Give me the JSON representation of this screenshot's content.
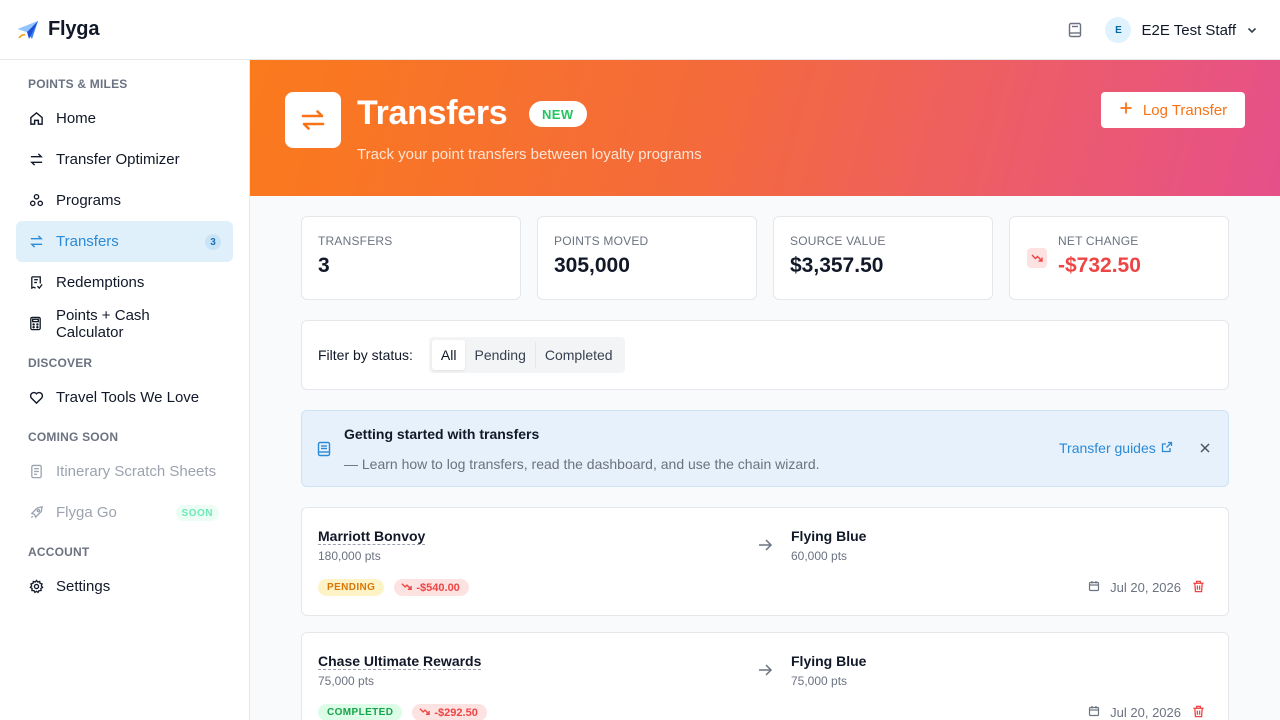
{
  "app": {
    "brand": "Flyga",
    "user_initial": "E",
    "user_name": "E2E Test Staff"
  },
  "sidebar": {
    "sections": [
      {
        "title": "POINTS & MILES",
        "items": [
          {
            "label": "Home",
            "icon": "home-icon"
          },
          {
            "label": "Transfer Optimizer",
            "icon": "swap-icon"
          },
          {
            "label": "Programs",
            "icon": "programs-icon"
          },
          {
            "label": "Transfers",
            "icon": "transfer-icon",
            "active": true,
            "count": "3"
          },
          {
            "label": "Redemptions",
            "icon": "receipt-icon"
          },
          {
            "label": "Points + Cash Calculator",
            "icon": "calculator-icon"
          }
        ]
      },
      {
        "title": "DISCOVER",
        "items": [
          {
            "label": "Travel Tools We Love",
            "icon": "heart-icon"
          }
        ]
      },
      {
        "title": "COMING SOON",
        "items": [
          {
            "label": "Itinerary Scratch Sheets",
            "icon": "notes-icon",
            "disabled": true
          },
          {
            "label": "Flyga Go",
            "icon": "rocket-icon",
            "disabled": true,
            "badge": "SOON"
          }
        ]
      },
      {
        "title": "ACCOUNT",
        "items": [
          {
            "label": "Settings",
            "icon": "gear-icon"
          }
        ]
      }
    ]
  },
  "hero": {
    "title": "Transfers",
    "badge": "NEW",
    "subtitle": "Track your point transfers between loyalty programs",
    "action": "Log Transfer"
  },
  "stats": [
    {
      "label": "TRANSFERS",
      "value": "3"
    },
    {
      "label": "POINTS MOVED",
      "value": "305,000"
    },
    {
      "label": "SOURCE VALUE",
      "value": "$3,357.50"
    },
    {
      "label": "NET CHANGE",
      "value": "-$732.50"
    }
  ],
  "filter": {
    "label": "Filter by status:",
    "options": [
      "All",
      "Pending",
      "Completed"
    ],
    "selected": "All"
  },
  "info": {
    "title": "Getting started with transfers",
    "description": "— Learn how to log transfers, read the dashboard, and use the chain wizard.",
    "link": "Transfer guides"
  },
  "transfers": [
    {
      "from_program": "Marriott Bonvoy",
      "from_points": "180,000 pts",
      "to_program": "Flying Blue",
      "to_points": "60,000 pts",
      "status": "PENDING",
      "change": "-$540.00",
      "date": "Jul 20, 2026"
    },
    {
      "from_program": "Chase Ultimate Rewards",
      "from_points": "75,000 pts",
      "to_program": "Flying Blue",
      "to_points": "75,000 pts",
      "status": "COMPLETED",
      "change": "-$292.50",
      "date": "Jul 20, 2026"
    }
  ],
  "colors": {
    "accent": "#2b8ad6",
    "hero_start": "#fb7a1c",
    "hero_end": "#e6508a",
    "negative": "#ef4444"
  }
}
